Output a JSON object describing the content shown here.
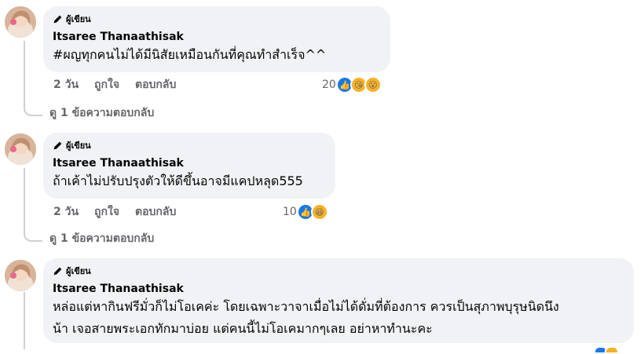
{
  "comments": [
    {
      "badge": "ผู้เขียน",
      "author": "Itsaree Thanaathisak",
      "text": "#ผญทุกคนไม่ได้มีนิสัยเหมือนกันที่คุณทำสำเร็จ^^",
      "time": "2 วัน",
      "like_label": "ถูกใจ",
      "reply_label": "ตอบกลับ",
      "reaction_count": "20",
      "reactions": [
        "like-icon",
        "kiss-face-icon",
        "wow-face-icon"
      ],
      "view_replies": "ดู 1 ข้อความตอบกลับ"
    },
    {
      "badge": "ผู้เขียน",
      "author": "Itsaree Thanaathisak",
      "text": "ถ้าเค้าไม่ปรับปรุงตัวให้ดีขึ้นอาจมีแคปหลุด555",
      "time": "2 วัน",
      "like_label": "ถูกใจ",
      "reply_label": "ตอบกลับ",
      "reaction_count": "10",
      "reactions": [
        "like-icon",
        "haha-face-icon"
      ],
      "view_replies": "ดู 1 ข้อความตอบกลับ"
    },
    {
      "badge": "ผู้เขียน",
      "author": "Itsaree Thanaathisak",
      "text_line1": "หล่อแต่หากินฟรีมั่วก็ไม่โอเคค่ะ โดยเฉพาะวาจาเมื่อไม่ได้ดั่มที่ต้องการ ควรเป็นสุภาพบุรุษนิดนึง",
      "text_line2": "น้า เจอสายพระเอกทักมาบ่อย แต่คนนี้ไม่โอเคมากๆเลย อย่าหาทำนะคะ"
    }
  ],
  "colors": {
    "bubble": "#f0f2f5",
    "meta": "#65676b",
    "like": "#1877f2",
    "emoji": "#f7b125"
  }
}
